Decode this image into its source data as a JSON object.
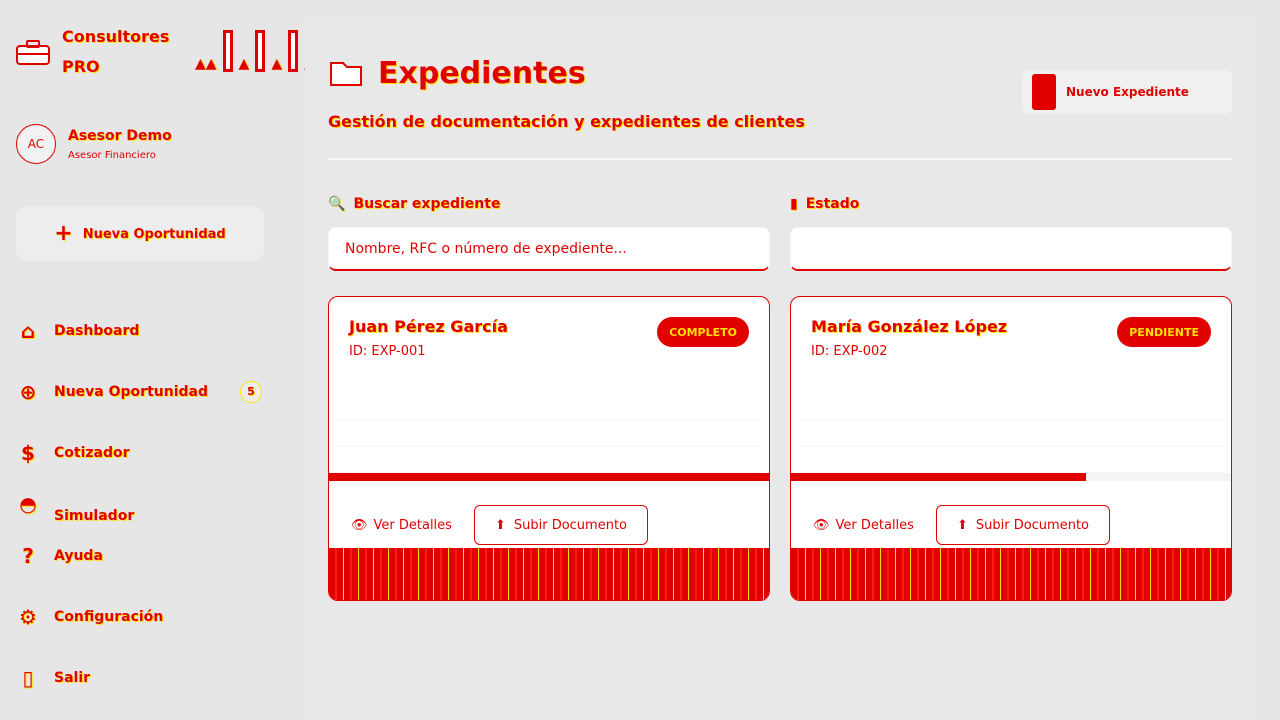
{
  "brand": {
    "line1": "Consultores",
    "line2": "PRO"
  },
  "user": {
    "initials": "AC",
    "name": "Asesor Demo",
    "role": "Asesor Financiero"
  },
  "sidebar": {
    "new_op_label": "Nueva Oportunidad",
    "items": [
      {
        "label": "Dashboard",
        "icon": "home-icon"
      },
      {
        "label": "Nueva Oportunidad",
        "icon": "target-icon",
        "badge": "5"
      },
      {
        "label": "Cotizador",
        "icon": "calculator-icon"
      },
      {
        "label": "Simulador",
        "icon": "chart-icon"
      },
      {
        "label": "Ayuda",
        "icon": "help-icon"
      },
      {
        "label": "Configuración",
        "icon": "gear-icon"
      },
      {
        "label": "Salir",
        "icon": "logout-icon"
      }
    ]
  },
  "header": {
    "title": "Expedientes",
    "subtitle": "Gestión de documentación y expedientes de clientes",
    "new_button": "Nuevo Expediente"
  },
  "filters": {
    "search_label": "Buscar expediente",
    "search_placeholder": "Nombre, RFC o número de expediente...",
    "status_label": "Estado"
  },
  "cards": [
    {
      "name": "Juan Pérez García",
      "id": "ID: EXP-001",
      "status": "COMPLETO",
      "progress": 1.0,
      "view_label": "Ver Detalles",
      "upload_label": "Subir Documento"
    },
    {
      "name": "María González López",
      "id": "ID: EXP-002",
      "status": "PENDIENTE",
      "progress": 0.67,
      "view_label": "Ver Detalles",
      "upload_label": "Subir Documento"
    }
  ]
}
